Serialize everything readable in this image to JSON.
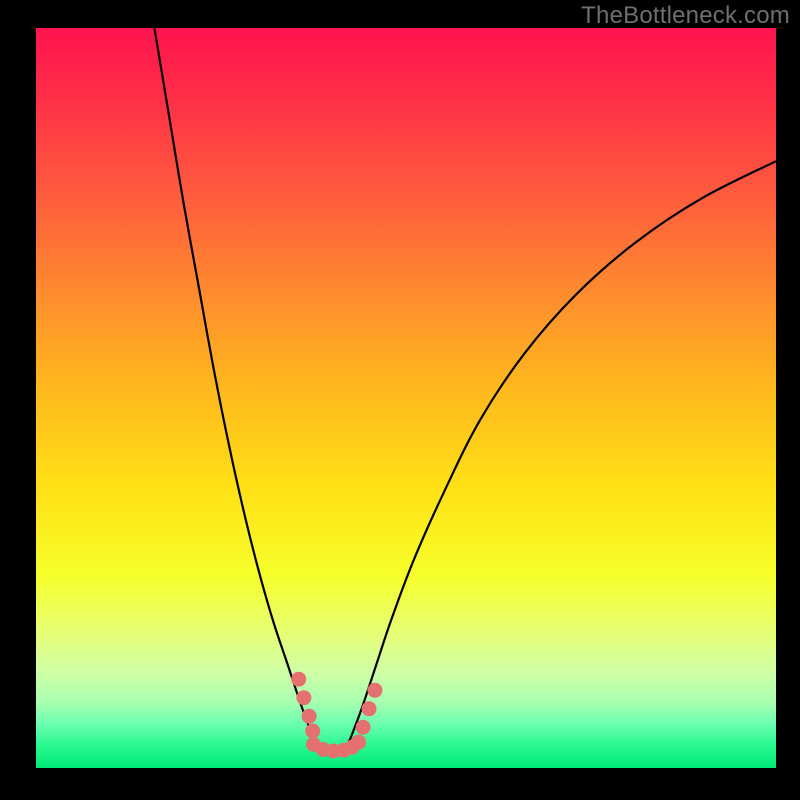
{
  "watermark": "TheBottleneck.com",
  "chart_data": {
    "type": "line",
    "title": "",
    "xlabel": "",
    "ylabel": "",
    "xlim": [
      0,
      100
    ],
    "ylim": [
      0,
      100
    ],
    "series": [
      {
        "name": "left-branch",
        "x": [
          16,
          18,
          20,
          22,
          24,
          26,
          28,
          30,
          32,
          34,
          36,
          37.5
        ],
        "values": [
          100,
          88,
          76,
          65,
          54,
          44,
          35,
          27,
          20,
          14,
          8,
          4
        ]
      },
      {
        "name": "right-branch",
        "x": [
          42.5,
          44,
          46,
          48,
          51,
          55,
          60,
          66,
          73,
          81,
          90,
          100
        ],
        "values": [
          4,
          8,
          14,
          20,
          28,
          37,
          47,
          56,
          64,
          71,
          77,
          82
        ]
      },
      {
        "name": "valley-floor",
        "x": [
          37.5,
          38.5,
          40,
          41.5,
          42.5
        ],
        "values": [
          4,
          2.5,
          2,
          2.5,
          4
        ]
      }
    ],
    "markers": [
      {
        "name": "left-wall-marker",
        "x": [
          35.5,
          36.2,
          36.9,
          37.4
        ],
        "values": [
          12,
          9.5,
          7,
          5
        ]
      },
      {
        "name": "floor-marker",
        "x": [
          37.5,
          38.8,
          40.2,
          41.6,
          42.7,
          43.6
        ],
        "values": [
          3.2,
          2.5,
          2.3,
          2.4,
          2.8,
          3.5
        ]
      },
      {
        "name": "right-wall-marker",
        "x": [
          44.2,
          45.0,
          45.8
        ],
        "values": [
          5.5,
          8,
          10.5
        ]
      }
    ],
    "grid": false,
    "legend": false,
    "notes": "Bottleneck-style V-curve over vertical rainbow gradient. Values estimated from pixel positions; axes are unlabeled in source image so 0-100 is assumed."
  }
}
